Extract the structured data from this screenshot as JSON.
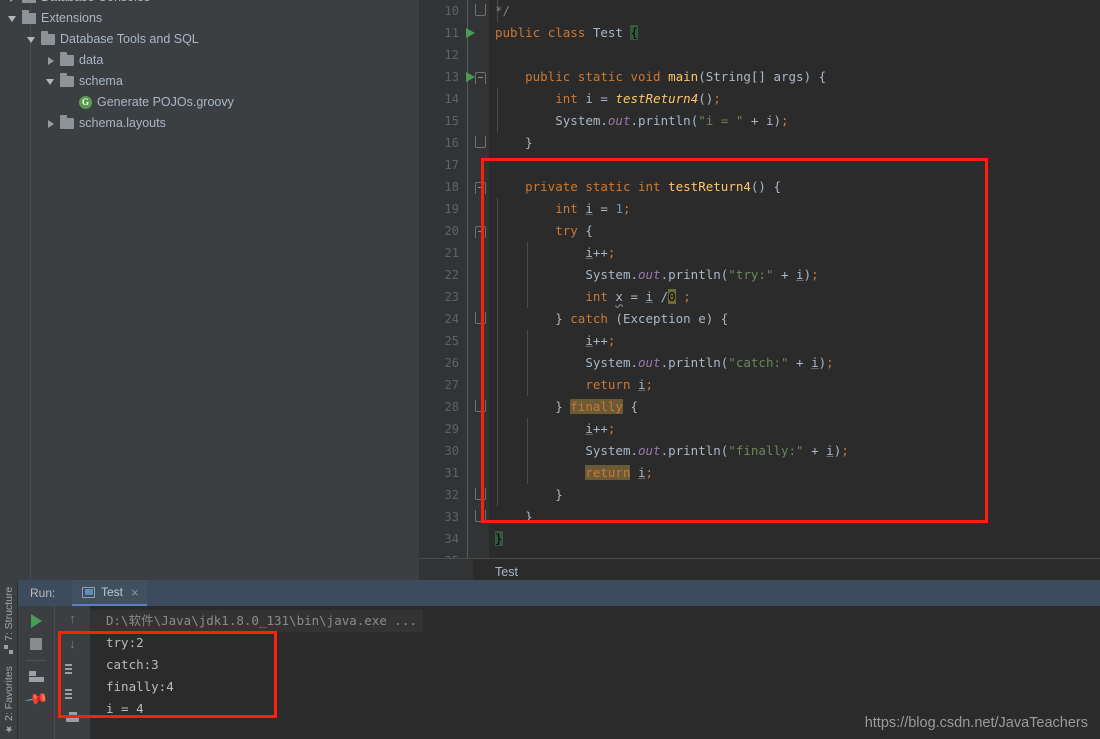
{
  "project_tree": {
    "items": [
      {
        "label": "Database Consoles",
        "indent": 0,
        "twisty": "right",
        "icon": "folder",
        "clipped": true
      },
      {
        "label": "Extensions",
        "indent": 0,
        "twisty": "down",
        "icon": "folder"
      },
      {
        "label": "Database Tools and SQL",
        "indent": 1,
        "twisty": "down",
        "icon": "folder"
      },
      {
        "label": "data",
        "indent": 2,
        "twisty": "right",
        "icon": "folder"
      },
      {
        "label": "schema",
        "indent": 2,
        "twisty": "down",
        "icon": "folder"
      },
      {
        "label": "Generate POJOs.groovy",
        "indent": 3,
        "twisty": "none",
        "icon": "groovy-file"
      },
      {
        "label": "schema.layouts",
        "indent": 2,
        "twisty": "right",
        "icon": "folder"
      }
    ]
  },
  "editor": {
    "breadcrumb": "Test",
    "lines": [
      {
        "num": "10",
        "run": false,
        "fold": "end",
        "tokens": [
          {
            "t": "*/",
            "c": "cmt"
          }
        ],
        "indent": 1
      },
      {
        "num": "11",
        "run": true,
        "fold": "none",
        "tokens": [
          {
            "t": "public ",
            "c": "kw"
          },
          {
            "t": "class ",
            "c": "kw"
          },
          {
            "t": "Test ",
            "c": "plain"
          },
          {
            "t": "{",
            "c": "hl-search"
          }
        ],
        "indent": 0
      },
      {
        "num": "12",
        "run": false,
        "fold": "none",
        "tokens": [],
        "indent": 0
      },
      {
        "num": "13",
        "run": true,
        "fold": "start",
        "tokens": [
          {
            "t": "    ",
            "c": "plain"
          },
          {
            "t": "public static void ",
            "c": "kw"
          },
          {
            "t": "main",
            "c": "fn"
          },
          {
            "t": "(String[] args) {",
            "c": "plain"
          }
        ],
        "indent": 0
      },
      {
        "num": "14",
        "run": false,
        "fold": "none",
        "tokens": [
          {
            "t": "        ",
            "c": "plain"
          },
          {
            "t": "int ",
            "c": "kw"
          },
          {
            "t": "i = ",
            "c": "plain"
          },
          {
            "t": "testReturn4",
            "c": "fni"
          },
          {
            "t": "()",
            "c": "plain"
          },
          {
            "t": ";",
            "c": "semi"
          }
        ],
        "indent": 1
      },
      {
        "num": "15",
        "run": false,
        "fold": "none",
        "tokens": [
          {
            "t": "        ",
            "c": "plain"
          },
          {
            "t": "System.",
            "c": "plain"
          },
          {
            "t": "out",
            "c": "stat"
          },
          {
            "t": ".println(",
            "c": "plain"
          },
          {
            "t": "\"i = \"",
            "c": "str"
          },
          {
            "t": " + i)",
            "c": "plain"
          },
          {
            "t": ";",
            "c": "semi"
          }
        ],
        "indent": 1
      },
      {
        "num": "16",
        "run": false,
        "fold": "end",
        "tokens": [
          {
            "t": "    }",
            "c": "plain"
          }
        ],
        "indent": 0
      },
      {
        "num": "17",
        "run": false,
        "fold": "none",
        "tokens": [],
        "indent": 0
      },
      {
        "num": "18",
        "run": false,
        "fold": "start",
        "tokens": [
          {
            "t": "    ",
            "c": "plain"
          },
          {
            "t": "private static int ",
            "c": "kw"
          },
          {
            "t": "testReturn4",
            "c": "fn"
          },
          {
            "t": "() {",
            "c": "plain"
          }
        ],
        "indent": 0
      },
      {
        "num": "19",
        "run": false,
        "fold": "none",
        "tokens": [
          {
            "t": "        ",
            "c": "plain"
          },
          {
            "t": "int ",
            "c": "kw"
          },
          {
            "t": "i",
            "c": "fld"
          },
          {
            "t": " = ",
            "c": "plain"
          },
          {
            "t": "1",
            "c": "num"
          },
          {
            "t": ";",
            "c": "semi"
          }
        ],
        "indent": 1
      },
      {
        "num": "20",
        "run": false,
        "fold": "start",
        "tokens": [
          {
            "t": "        ",
            "c": "plain"
          },
          {
            "t": "try",
            "c": "kw"
          },
          {
            "t": " {",
            "c": "plain"
          }
        ],
        "indent": 1
      },
      {
        "num": "21",
        "run": false,
        "fold": "none",
        "tokens": [
          {
            "t": "            ",
            "c": "plain"
          },
          {
            "t": "i",
            "c": "fld"
          },
          {
            "t": "++",
            "c": "plain"
          },
          {
            "t": ";",
            "c": "semi"
          }
        ],
        "indent": 2
      },
      {
        "num": "22",
        "run": false,
        "fold": "none",
        "tokens": [
          {
            "t": "            ",
            "c": "plain"
          },
          {
            "t": "System.",
            "c": "plain"
          },
          {
            "t": "out",
            "c": "stat"
          },
          {
            "t": ".println(",
            "c": "plain"
          },
          {
            "t": "\"try:\"",
            "c": "str"
          },
          {
            "t": " + ",
            "c": "plain"
          },
          {
            "t": "i",
            "c": "fld"
          },
          {
            "t": ")",
            "c": "plain"
          },
          {
            "t": ";",
            "c": "semi"
          }
        ],
        "indent": 2
      },
      {
        "num": "23",
        "run": false,
        "fold": "none",
        "tokens": [
          {
            "t": "            ",
            "c": "plain"
          },
          {
            "t": "int ",
            "c": "kw"
          },
          {
            "t": "x",
            "c": "err"
          },
          {
            "t": " = ",
            "c": "plain"
          },
          {
            "t": "i",
            "c": "fld"
          },
          {
            "t": " /",
            "c": "plain"
          },
          {
            "t": "0",
            "c": "hl-warn"
          },
          {
            "t": " ",
            "c": "plain"
          },
          {
            "t": ";",
            "c": "semi"
          }
        ],
        "indent": 2
      },
      {
        "num": "24",
        "run": false,
        "fold": "end",
        "tokens": [
          {
            "t": "        } ",
            "c": "plain"
          },
          {
            "t": "catch",
            "c": "kw"
          },
          {
            "t": " (Exception e) {",
            "c": "plain"
          }
        ],
        "indent": 1
      },
      {
        "num": "25",
        "run": false,
        "fold": "none",
        "tokens": [
          {
            "t": "            ",
            "c": "plain"
          },
          {
            "t": "i",
            "c": "fld"
          },
          {
            "t": "++",
            "c": "plain"
          },
          {
            "t": ";",
            "c": "semi"
          }
        ],
        "indent": 2
      },
      {
        "num": "26",
        "run": false,
        "fold": "none",
        "tokens": [
          {
            "t": "            ",
            "c": "plain"
          },
          {
            "t": "System.",
            "c": "plain"
          },
          {
            "t": "out",
            "c": "stat"
          },
          {
            "t": ".println(",
            "c": "plain"
          },
          {
            "t": "\"catch:\"",
            "c": "str"
          },
          {
            "t": " + ",
            "c": "plain"
          },
          {
            "t": "i",
            "c": "fld"
          },
          {
            "t": ")",
            "c": "plain"
          },
          {
            "t": ";",
            "c": "semi"
          }
        ],
        "indent": 2
      },
      {
        "num": "27",
        "run": false,
        "fold": "none",
        "tokens": [
          {
            "t": "            ",
            "c": "plain"
          },
          {
            "t": "return ",
            "c": "kw"
          },
          {
            "t": "i",
            "c": "fld"
          },
          {
            "t": ";",
            "c": "semi"
          }
        ],
        "indent": 2
      },
      {
        "num": "28",
        "run": false,
        "fold": "end",
        "tokens": [
          {
            "t": "        } ",
            "c": "plain"
          },
          {
            "t": "finally",
            "c": "hl-kw kw"
          },
          {
            "t": " {",
            "c": "plain"
          }
        ],
        "indent": 1
      },
      {
        "num": "29",
        "run": false,
        "fold": "none",
        "tokens": [
          {
            "t": "            ",
            "c": "plain"
          },
          {
            "t": "i",
            "c": "fld"
          },
          {
            "t": "++",
            "c": "plain"
          },
          {
            "t": ";",
            "c": "semi"
          }
        ],
        "indent": 2
      },
      {
        "num": "30",
        "run": false,
        "fold": "none",
        "tokens": [
          {
            "t": "            ",
            "c": "plain"
          },
          {
            "t": "System.",
            "c": "plain"
          },
          {
            "t": "out",
            "c": "stat"
          },
          {
            "t": ".println(",
            "c": "plain"
          },
          {
            "t": "\"finally:\"",
            "c": "str"
          },
          {
            "t": " + ",
            "c": "plain"
          },
          {
            "t": "i",
            "c": "fld"
          },
          {
            "t": ")",
            "c": "plain"
          },
          {
            "t": ";",
            "c": "semi"
          }
        ],
        "indent": 2
      },
      {
        "num": "31",
        "run": false,
        "fold": "none",
        "tokens": [
          {
            "t": "            ",
            "c": "plain"
          },
          {
            "t": "return",
            "c": "hl-kw kw"
          },
          {
            "t": " ",
            "c": "plain"
          },
          {
            "t": "i",
            "c": "fld"
          },
          {
            "t": ";",
            "c": "semi"
          }
        ],
        "indent": 2
      },
      {
        "num": "32",
        "run": false,
        "fold": "end",
        "tokens": [
          {
            "t": "        }",
            "c": "plain"
          }
        ],
        "indent": 1
      },
      {
        "num": "33",
        "run": false,
        "fold": "end",
        "tokens": [
          {
            "t": "    }",
            "c": "plain"
          }
        ],
        "indent": 0
      },
      {
        "num": "34",
        "run": false,
        "fold": "none",
        "tokens": [
          {
            "t": "}",
            "c": "hl-search"
          }
        ],
        "indent": 0
      },
      {
        "num": "35",
        "run": false,
        "fold": "none",
        "tokens": [],
        "indent": 0
      }
    ]
  },
  "left_strip": {
    "structure_label": "7: Structure",
    "favorites_label": "2: Favorites"
  },
  "run_panel": {
    "run_label": "Run:",
    "tab_title": "Test",
    "tab_close": "×",
    "toolbar": {
      "rerun": "rerun-button",
      "stop": "stop-button",
      "layout": "layout-button",
      "pin": "pin-tab-button",
      "up": "↑",
      "down": "↓",
      "soft_wrap": "soft-wrap-button",
      "scroll_end": "scroll-to-end-button",
      "print": "print-button"
    },
    "console_lines": [
      {
        "text": "D:\\软件\\Java\\jdk1.8.0_131\\bin\\java.exe ...",
        "kind": "path"
      },
      {
        "text": "try:2",
        "kind": "out"
      },
      {
        "text": "catch:3",
        "kind": "out"
      },
      {
        "text": "finally:4",
        "kind": "out"
      },
      {
        "text": "i = 4",
        "kind": "out"
      }
    ]
  },
  "annotations": {
    "box_color": "#fc2009",
    "editor_box": "highlight-testReturn4-method",
    "console_box": "highlight-console-output"
  },
  "watermark": "https://blog.csdn.net/JavaTeachers"
}
